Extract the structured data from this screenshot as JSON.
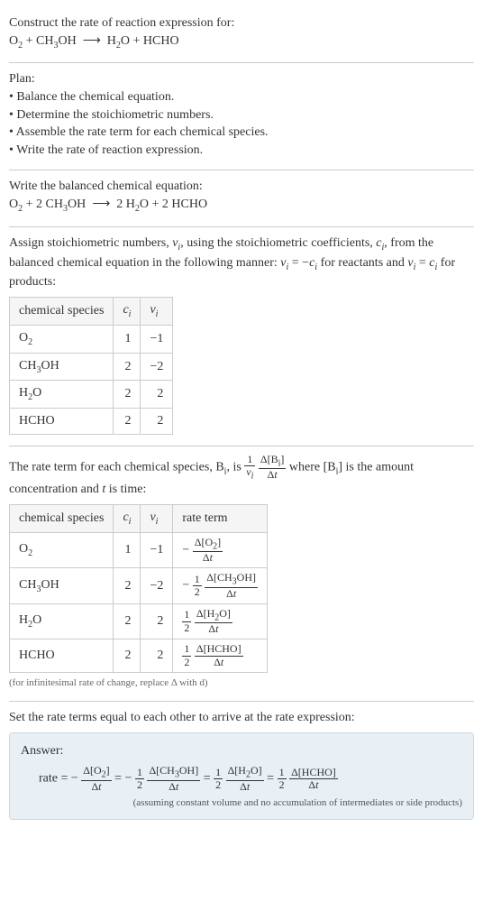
{
  "intro": {
    "heading": "Construct the rate of reaction expression for:",
    "equation_html": "O<span class='sub'>2</span> + CH<span class='sub'>3</span>OH &nbsp;⟶&nbsp; H<span class='sub'>2</span>O + HCHO"
  },
  "plan": {
    "heading": "Plan:",
    "items": [
      "Balance the chemical equation.",
      "Determine the stoichiometric numbers.",
      "Assemble the rate term for each chemical species.",
      "Write the rate of reaction expression."
    ]
  },
  "balanced": {
    "heading": "Write the balanced chemical equation:",
    "equation_html": "O<span class='sub'>2</span> + 2 CH<span class='sub'>3</span>OH &nbsp;⟶&nbsp; 2 H<span class='sub'>2</span>O + 2 HCHO"
  },
  "stoich": {
    "heading_html": "Assign stoichiometric numbers, <i>ν<span class='sub'>i</span></i>, using the stoichiometric coefficients, <i>c<span class='sub'>i</span></i>, from the balanced chemical equation in the following manner: <i>ν<span class='sub'>i</span></i> = −<i>c<span class='sub'>i</span></i> for reactants and <i>ν<span class='sub'>i</span></i> = <i>c<span class='sub'>i</span></i> for products:",
    "headers": [
      "chemical species",
      "cᵢ",
      "νᵢ"
    ],
    "headers_html": [
      "chemical species",
      "<i>c<span class='sub'>i</span></i>",
      "<i>ν<span class='sub'>i</span></i>"
    ],
    "rows": [
      {
        "species_html": "O<span class='sub'>2</span>",
        "c": "1",
        "nu": "−1"
      },
      {
        "species_html": "CH<span class='sub'>3</span>OH",
        "c": "2",
        "nu": "−2"
      },
      {
        "species_html": "H<span class='sub'>2</span>O",
        "c": "2",
        "nu": "2"
      },
      {
        "species_html": "HCHO",
        "c": "2",
        "nu": "2"
      }
    ]
  },
  "rateterm": {
    "heading_html": "The rate term for each chemical species, B<span class='sub'>i</span>, is <span class='frac'><span class='num-top'>1</span><span class='den'><i>ν<span class='sub'>i</span></i></span></span> <span class='frac'><span class='num-top'>Δ[B<span class='sub'>i</span>]</span><span class='den'>Δ<i>t</i></span></span> where [B<span class='sub'>i</span>] is the amount concentration and <i>t</i> is time:",
    "headers_html": [
      "chemical species",
      "<i>c<span class='sub'>i</span></i>",
      "<i>ν<span class='sub'>i</span></i>",
      "rate term"
    ],
    "rows": [
      {
        "species_html": "O<span class='sub'>2</span>",
        "c": "1",
        "nu": "−1",
        "rate_html": "− <span class='frac'><span class='num-top'>Δ[O<span class='sub'>2</span>]</span><span class='den'>Δ<i>t</i></span></span>"
      },
      {
        "species_html": "CH<span class='sub'>3</span>OH",
        "c": "2",
        "nu": "−2",
        "rate_html": "− <span class='frac'><span class='num-top'>1</span><span class='den'>2</span></span> <span class='frac'><span class='num-top'>Δ[CH<span class='sub'>3</span>OH]</span><span class='den'>Δ<i>t</i></span></span>"
      },
      {
        "species_html": "H<span class='sub'>2</span>O",
        "c": "2",
        "nu": "2",
        "rate_html": "<span class='frac'><span class='num-top'>1</span><span class='den'>2</span></span> <span class='frac'><span class='num-top'>Δ[H<span class='sub'>2</span>O]</span><span class='den'>Δ<i>t</i></span></span>"
      },
      {
        "species_html": "HCHO",
        "c": "2",
        "nu": "2",
        "rate_html": "<span class='frac'><span class='num-top'>1</span><span class='den'>2</span></span> <span class='frac'><span class='num-top'>Δ[HCHO]</span><span class='den'>Δ<i>t</i></span></span>"
      }
    ],
    "footnote": "(for infinitesimal rate of change, replace Δ with d)"
  },
  "final": {
    "heading": "Set the rate terms equal to each other to arrive at the rate expression:",
    "answer_label": "Answer:",
    "equation_html": "rate = − <span class='frac'><span class='num-top'>Δ[O<span class='sub'>2</span>]</span><span class='den'>Δ<i>t</i></span></span> = − <span class='frac'><span class='num-top'>1</span><span class='den'>2</span></span> <span class='frac'><span class='num-top'>Δ[CH<span class='sub'>3</span>OH]</span><span class='den'>Δ<i>t</i></span></span> = <span class='frac'><span class='num-top'>1</span><span class='den'>2</span></span> <span class='frac'><span class='num-top'>Δ[H<span class='sub'>2</span>O]</span><span class='den'>Δ<i>t</i></span></span> = <span class='frac'><span class='num-top'>1</span><span class='den'>2</span></span> <span class='frac'><span class='num-top'>Δ[HCHO]</span><span class='den'>Δ<i>t</i></span></span>",
    "note": "(assuming constant volume and no accumulation of intermediates or side products)"
  },
  "chart_data": {
    "type": "table",
    "tables": [
      {
        "title": "Stoichiometric numbers",
        "columns": [
          "chemical species",
          "c_i",
          "nu_i"
        ],
        "rows": [
          [
            "O2",
            1,
            -1
          ],
          [
            "CH3OH",
            2,
            -2
          ],
          [
            "H2O",
            2,
            2
          ],
          [
            "HCHO",
            2,
            2
          ]
        ]
      },
      {
        "title": "Rate terms",
        "columns": [
          "chemical species",
          "c_i",
          "nu_i",
          "rate term"
        ],
        "rows": [
          [
            "O2",
            1,
            -1,
            "-Δ[O2]/Δt"
          ],
          [
            "CH3OH",
            2,
            -2,
            "-(1/2) Δ[CH3OH]/Δt"
          ],
          [
            "H2O",
            2,
            2,
            "(1/2) Δ[H2O]/Δt"
          ],
          [
            "HCHO",
            2,
            2,
            "(1/2) Δ[HCHO]/Δt"
          ]
        ]
      }
    ]
  }
}
